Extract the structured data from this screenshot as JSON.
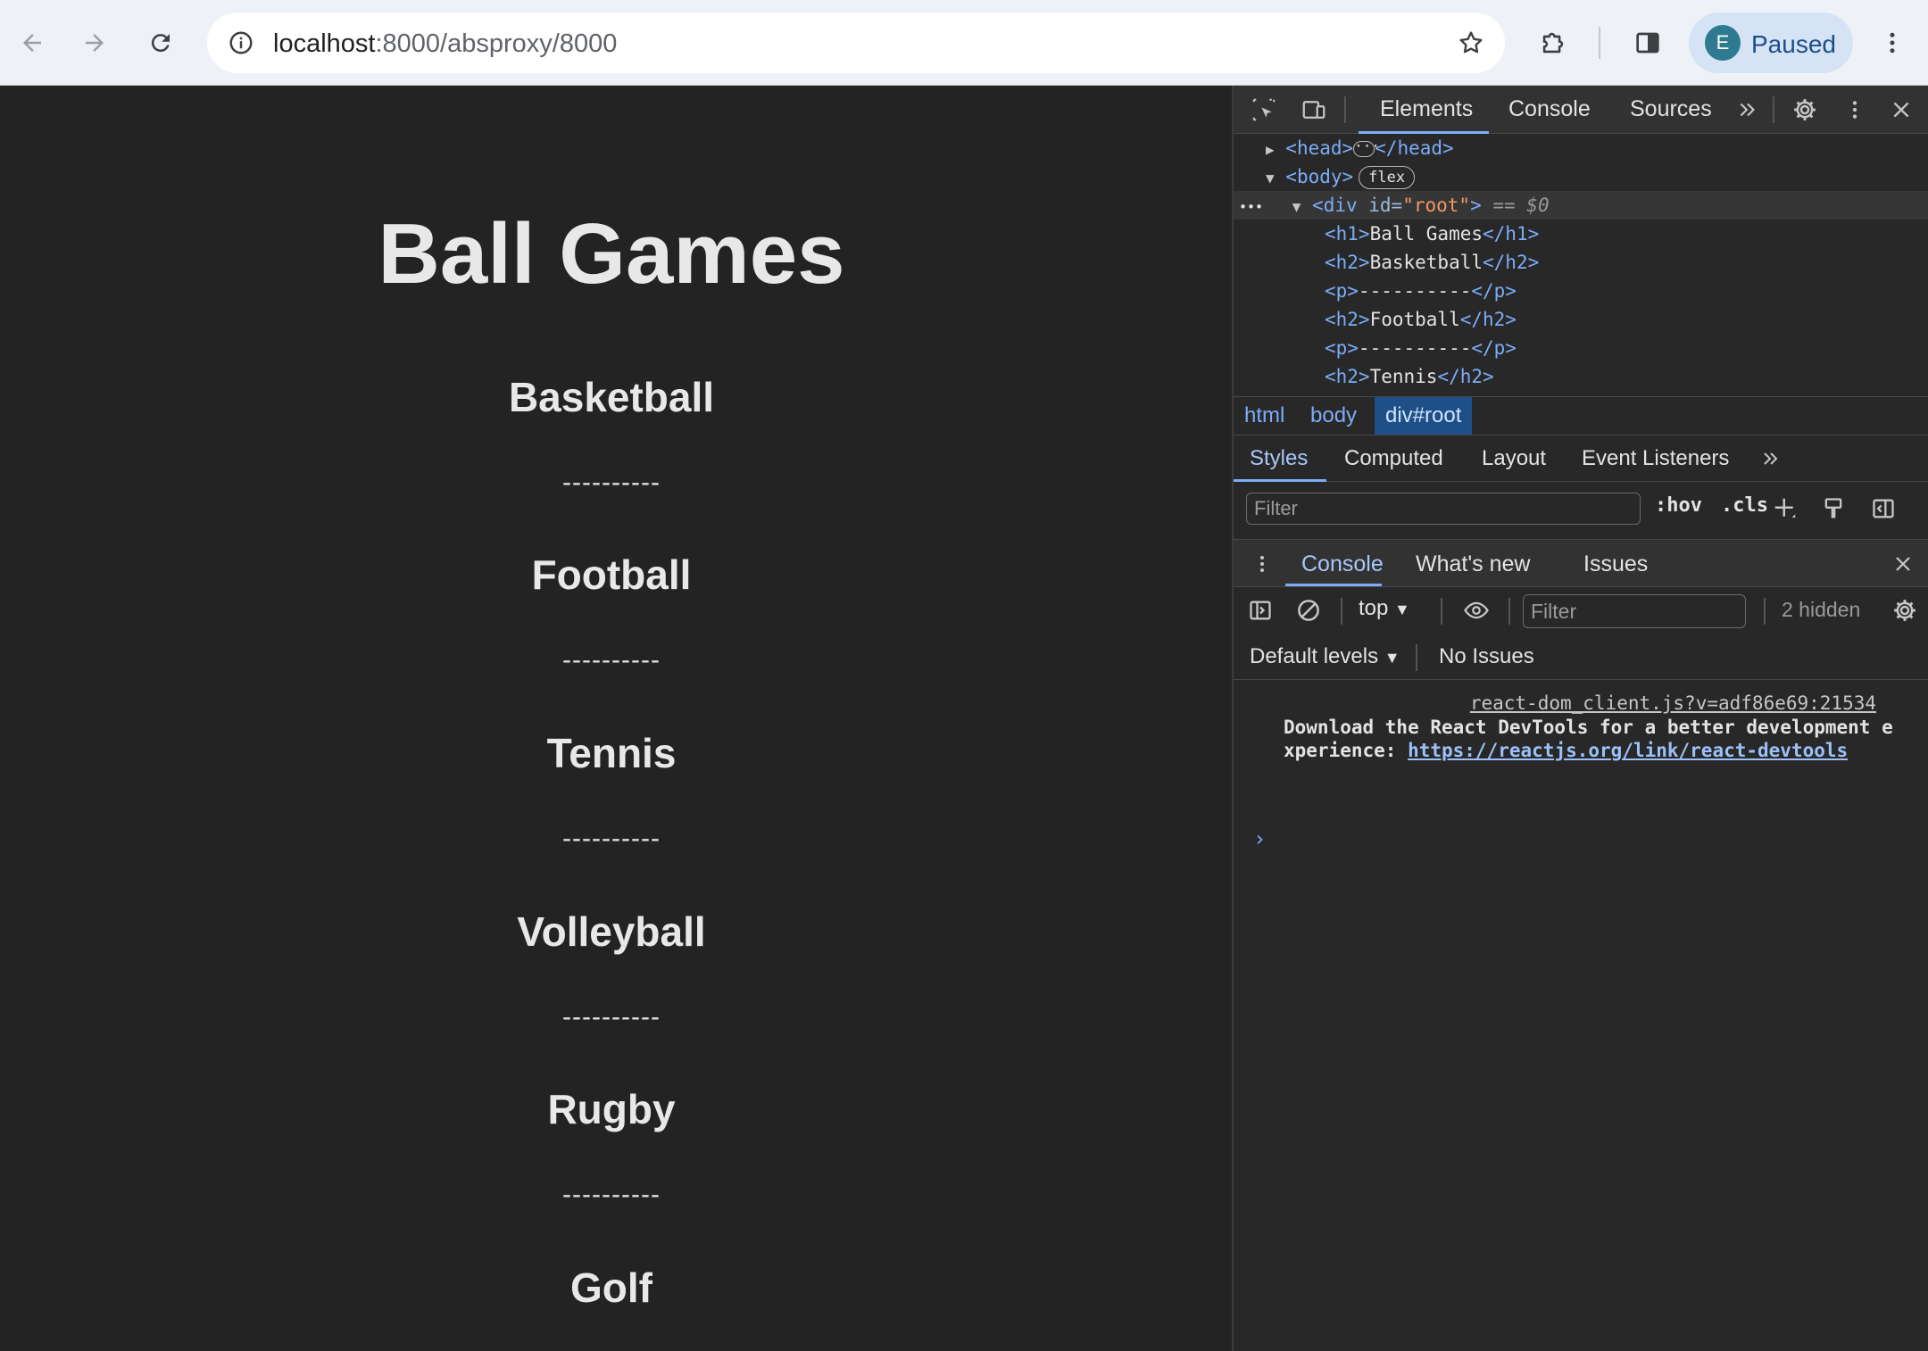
{
  "browser": {
    "url_host": "localhost",
    "url_rest": ":8000/absproxy/8000",
    "profile_initial": "E",
    "profile_status": "Paused"
  },
  "page": {
    "h1": "Ball Games",
    "sections": [
      {
        "title": "Basketball",
        "divider": "----------"
      },
      {
        "title": "Football",
        "divider": "----------"
      },
      {
        "title": "Tennis",
        "divider": "----------"
      },
      {
        "title": "Volleyball",
        "divider": "----------"
      },
      {
        "title": "Rugby",
        "divider": "----------"
      },
      {
        "title": "Golf"
      }
    ]
  },
  "devtools": {
    "tabs": [
      "Elements",
      "Console",
      "Sources"
    ],
    "tree": {
      "head_open": "<head>",
      "head_close": "</head>",
      "body_open": "<body>",
      "body_badge": "flex",
      "ellipsis": "•••",
      "root_tag": "<div ",
      "root_attr": "id=",
      "root_val": "\"root\"",
      "root_close": ">",
      "root_marker": "== $0",
      "lines": [
        {
          "open": "<h1>",
          "text": "Ball Games",
          "close": "</h1>"
        },
        {
          "open": "<h2>",
          "text": "Basketball",
          "close": "</h2>"
        },
        {
          "open": "<p>",
          "text": "----------",
          "close": "</p>"
        },
        {
          "open": "<h2>",
          "text": "Football",
          "close": "</h2>"
        },
        {
          "open": "<p>",
          "text": "----------",
          "close": "</p>"
        },
        {
          "open": "<h2>",
          "text": "Tennis",
          "close": "</h2>"
        }
      ]
    },
    "breadcrumb": [
      "html",
      "body",
      "div#root"
    ],
    "styles_tabs": [
      "Styles",
      "Computed",
      "Layout",
      "Event Listeners"
    ],
    "styles_filter_placeholder": "Filter",
    "hov": ":hov",
    "cls": ".cls",
    "drawer_tabs": [
      "Console",
      "What's new",
      "Issues"
    ],
    "console": {
      "context": "top",
      "filter_placeholder": "Filter",
      "hidden": "2 hidden",
      "levels": "Default levels",
      "issues": "No Issues",
      "source": "react-dom_client.js?v=adf86e69:21534",
      "message": "Download the React DevTools for a better development experience: ",
      "link": "https://reactjs.org/link/react-devtools",
      "prompt": "›"
    }
  }
}
